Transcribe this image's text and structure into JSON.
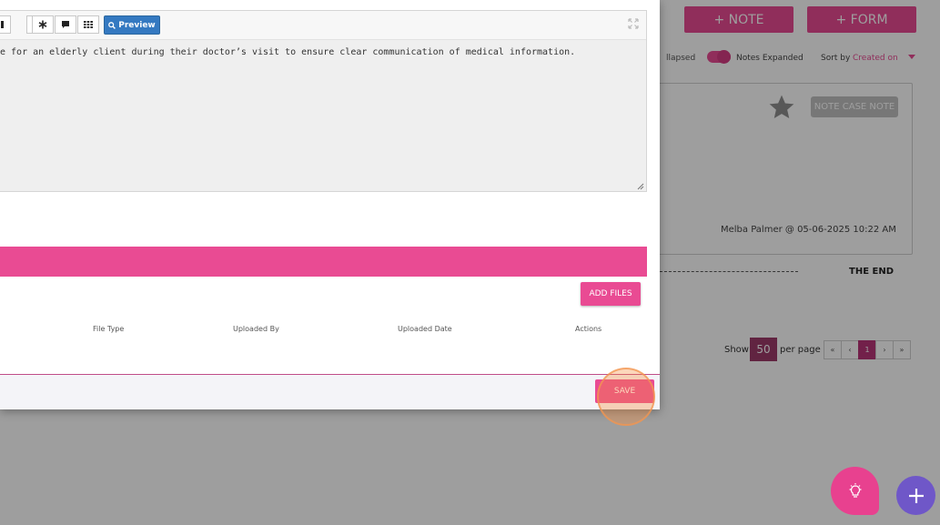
{
  "background": {
    "note_button": "+ NOTE",
    "form_button": "+ FORM",
    "collapsed_label": "llapsed",
    "expanded_label": "Notes Expanded",
    "sort_by_label": "Sort by",
    "sort_by_value": "Created on",
    "note_badge": "NOTE CASE NOTE",
    "note_author": "Melba Palmer @ 05-06-2025 10:22 AM",
    "the_end": "THE END",
    "show_label": "Show",
    "per_page_value": "50",
    "per_page_label": "per page",
    "pager": [
      "«",
      "‹",
      "1",
      "›",
      "»"
    ]
  },
  "editor": {
    "preview_label": "Preview",
    "text": "e for an elderly client during their doctor’s visit to ensure clear communication of medical information."
  },
  "files": {
    "add_files_label": "ADD FILES",
    "columns": [
      "File Type",
      "Uploaded By",
      "Uploaded Date",
      "Actions"
    ]
  },
  "footer": {
    "save_label": "SAVE"
  },
  "colors": {
    "accent": "#e94b93",
    "preview_blue": "#3479c1",
    "fab_purple": "#6f57c8"
  }
}
